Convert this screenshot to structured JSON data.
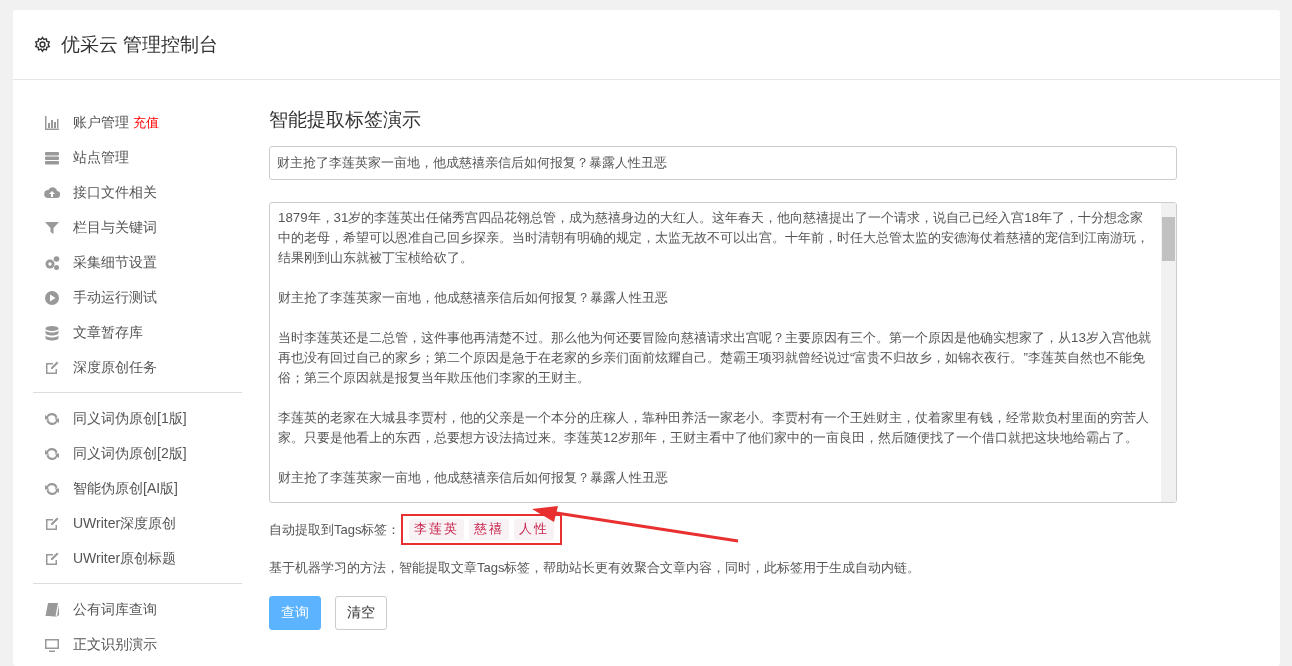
{
  "header": {
    "title": "优采云 管理控制台"
  },
  "sidebar": {
    "groups": [
      [
        {
          "label": "账户管理",
          "badge": "充值"
        },
        {
          "label": "站点管理"
        },
        {
          "label": "接口文件相关"
        },
        {
          "label": "栏目与关键词"
        },
        {
          "label": "采集细节设置"
        },
        {
          "label": "手动运行测试"
        },
        {
          "label": "文章暂存库"
        },
        {
          "label": "深度原创任务"
        }
      ],
      [
        {
          "label": "同义词伪原创[1版]"
        },
        {
          "label": "同义词伪原创[2版]"
        },
        {
          "label": "智能伪原创[AI版]"
        },
        {
          "label": "UWriter深度原创"
        },
        {
          "label": "UWriter原创标题"
        }
      ],
      [
        {
          "label": "公有词库查询"
        },
        {
          "label": "正文识别演示"
        }
      ]
    ]
  },
  "main": {
    "heading": "智能提取标签演示",
    "title_field": {
      "value": "财主抢了李莲英家一亩地，他成慈禧亲信后如何报复？暴露人性丑恶"
    },
    "content_field": {
      "paragraphs": [
        "1879年，31岁的李莲英出任储秀宫四品花翎总管，成为慈禧身边的大红人。这年春天，他向慈禧提出了一个请求，说自己已经入宫18年了，十分想念家中的老母，希望可以恩准自己回乡探亲。当时清朝有明确的规定，太监无故不可以出宫。十年前，时任大总管太监的安德海仗着慈禧的宠信到江南游玩，结果刚到山东就被丁宝桢给砍了。",
        "财主抢了李莲英家一亩地，他成慈禧亲信后如何报复？暴露人性丑恶",
        "当时李莲英还是二总管，这件事他再清楚不过。那么他为何还要冒险向慈禧请求出宫呢？主要原因有三个。第一个原因是他确实想家了，从13岁入宫他就再也没有回过自己的家乡；第二个原因是急于在老家的乡亲们面前炫耀自己。楚霸王项羽就曾经说过“富贵不归故乡，如锦衣夜行。”李莲英自然也不能免俗；第三个原因就是报复当年欺压他们李家的王财主。",
        "李莲英的老家在大城县李贾村，他的父亲是一个本分的庄稼人，靠种田养活一家老小。李贾村有一个王姓财主，仗着家里有钱，经常欺负村里面的穷苦人家。只要是他看上的东西，总要想方设法搞过来。李莲英12岁那年，王财主看中了他们家中的一亩良田，然后随便找了一个借口就把这块地给霸占了。",
        "财主抢了李莲英家一亩地，他成慈禧亲信后如何报复？暴露人性丑恶"
      ]
    },
    "tags_label": "自动提取到Tags标签：",
    "tags": [
      "李莲英",
      "慈禧",
      "人性"
    ],
    "description": "基于机器学习的方法，智能提取文章Tags标签，帮助站长更有效聚合文章内容，同时，此标签用于生成自动内链。",
    "buttons": [
      {
        "label": "查询",
        "kind": "primary"
      },
      {
        "label": "清空",
        "kind": "default"
      }
    ]
  }
}
